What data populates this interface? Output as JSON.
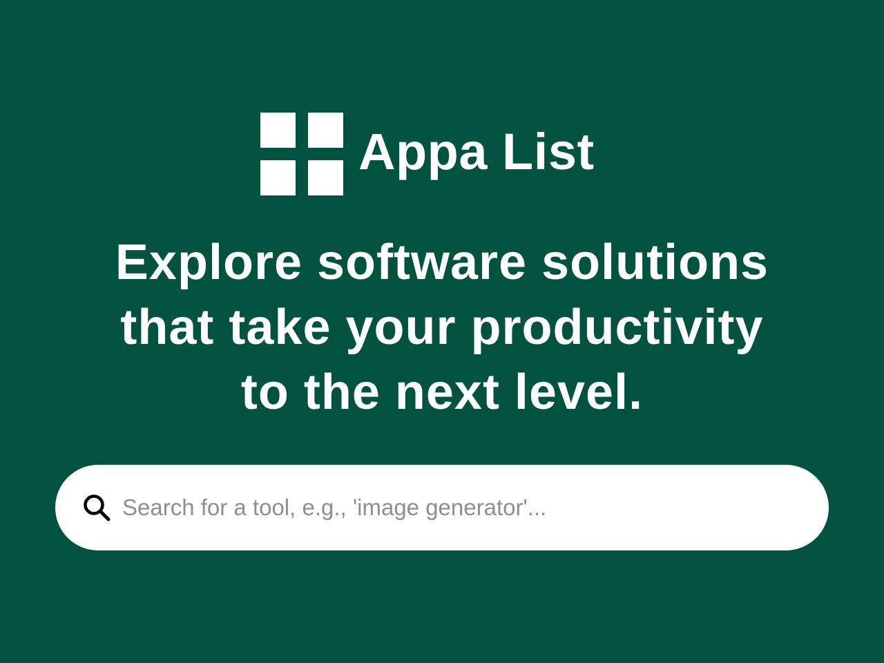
{
  "brand": {
    "logo_icon": "four-squares-grid-logo",
    "name": "Appa List"
  },
  "hero": {
    "headline_lines": [
      "Explore software solutions",
      "that take your productivity",
      "to the next level."
    ]
  },
  "search": {
    "icon": "search-icon",
    "value": "",
    "placeholder": "Search for a tool, e.g., 'image generator'..."
  },
  "colors": {
    "background": "#015340",
    "text": "#ffffff",
    "search_background": "#ffffff",
    "placeholder": "#8a8f96"
  }
}
